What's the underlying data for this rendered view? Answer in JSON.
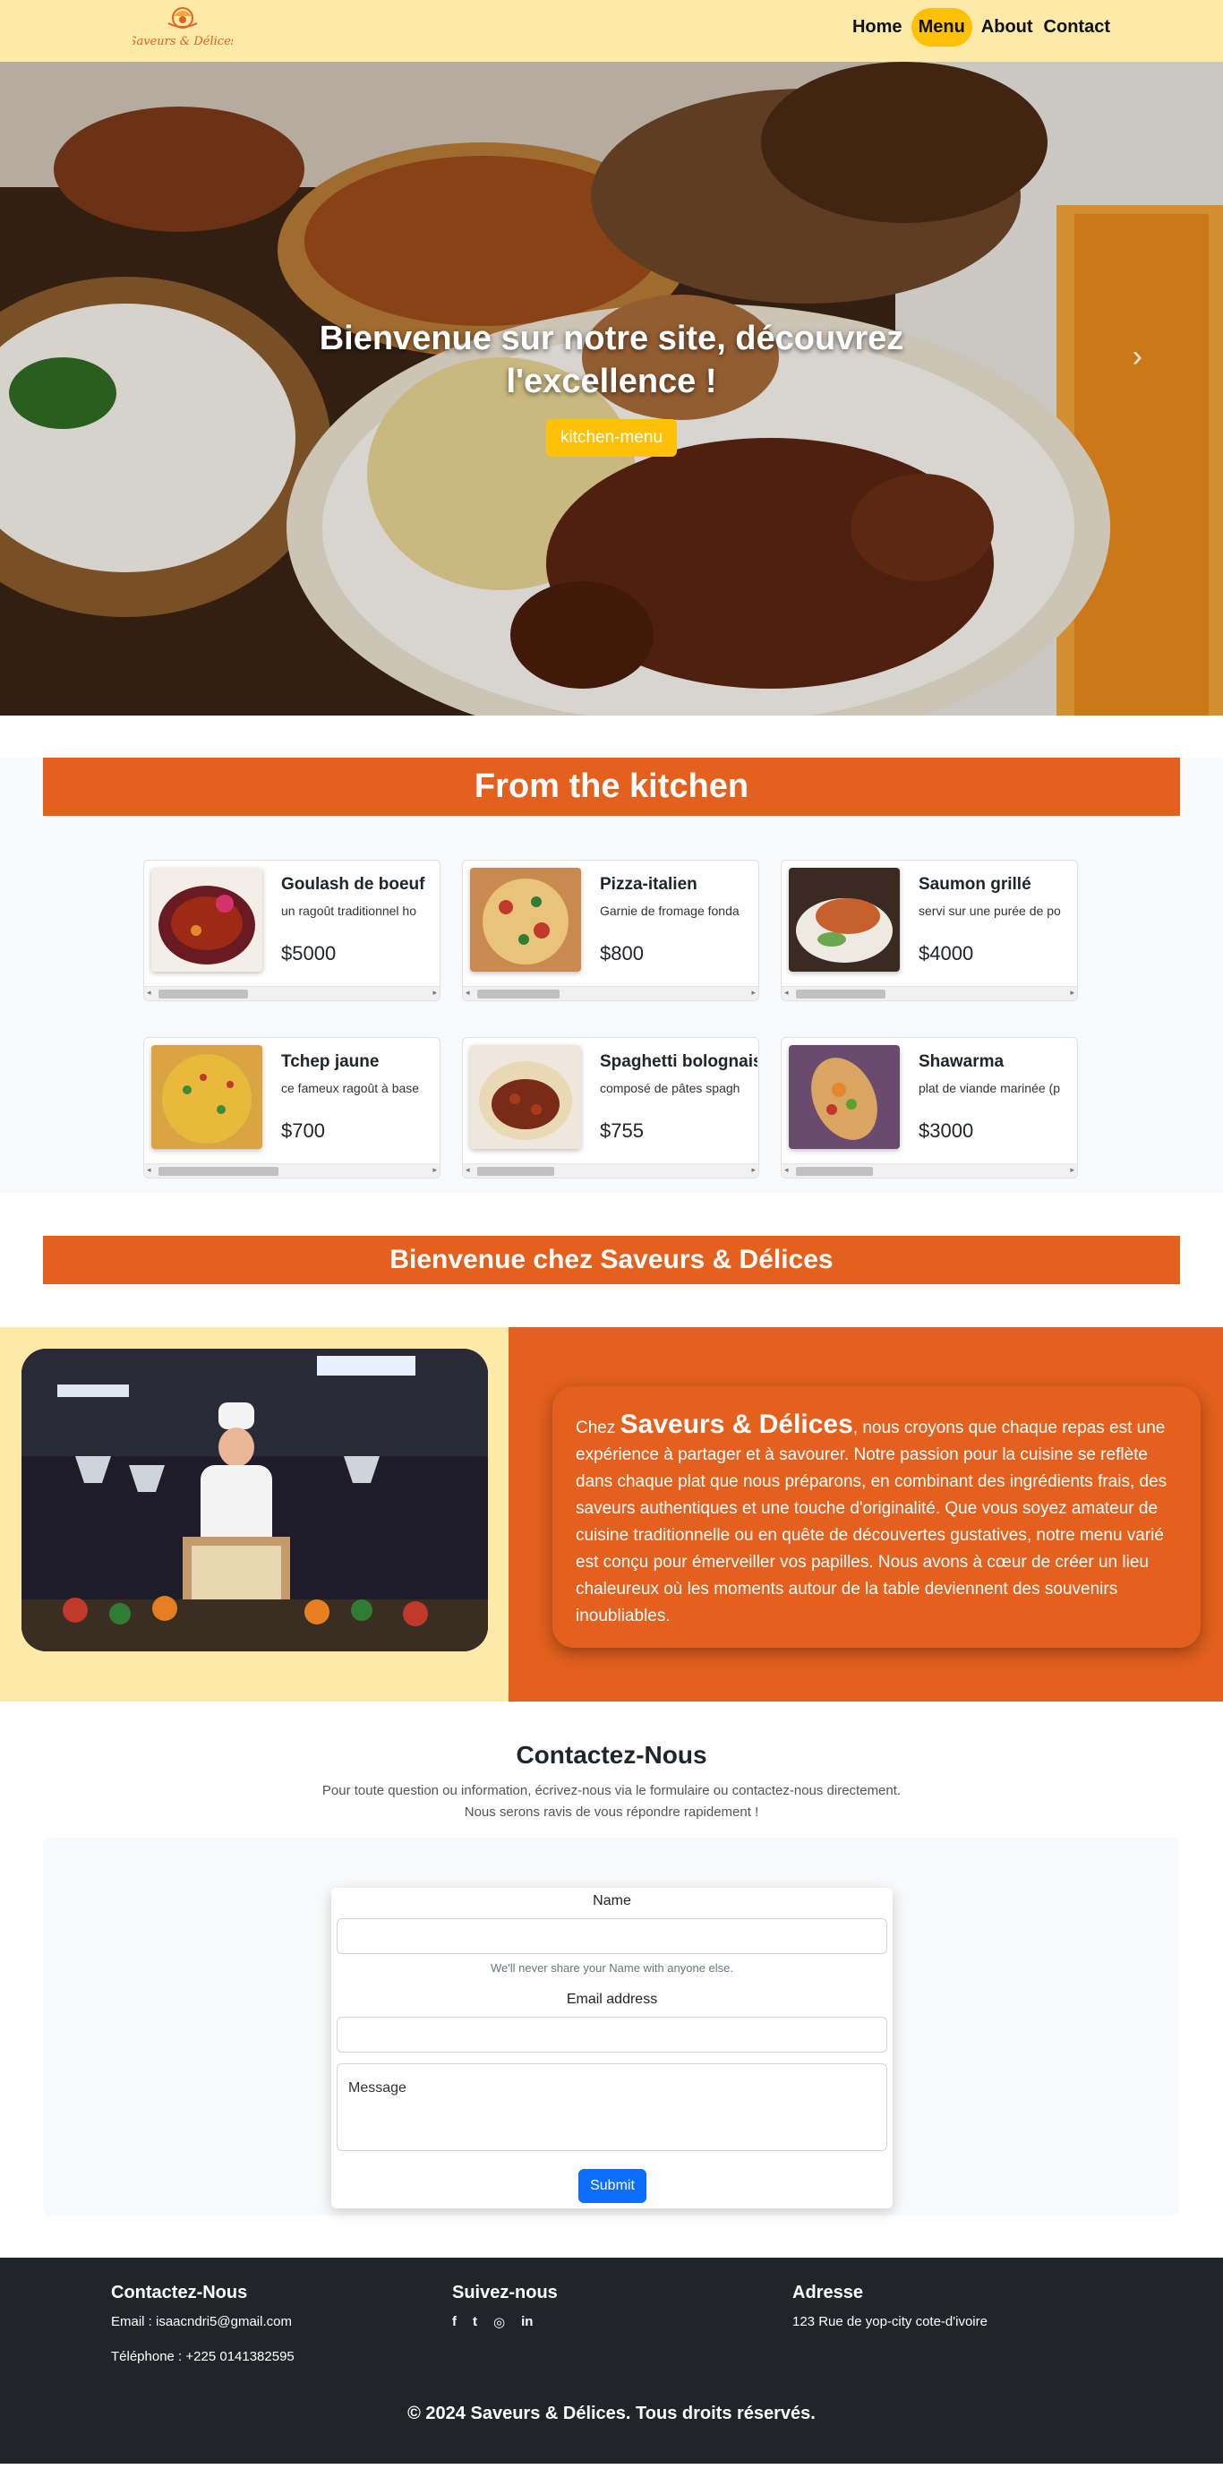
{
  "nav": {
    "logo_text": "Saveurs & Délices",
    "links": [
      {
        "label": "Home"
      },
      {
        "label": "Menu"
      },
      {
        "label": "About"
      },
      {
        "label": "Contact"
      }
    ],
    "active_link": "Menu"
  },
  "hero": {
    "title_line1": "Bienvenue sur notre site, découvrez",
    "title_line2": "l'excellence !",
    "button_label": "kitchen-menu",
    "next_icon": "chevron-right-icon"
  },
  "kitchen": {
    "title": "From the kitchen",
    "items": [
      {
        "name": "Goulash de boeuf",
        "desc": "un ragoût traditionnel ho",
        "price": "$5000"
      },
      {
        "name": "Pizza-italien",
        "desc": "Garnie de fromage fonda",
        "price": "$800"
      },
      {
        "name": "Saumon grillé",
        "desc": "servi sur une purée de po",
        "price": "$4000"
      },
      {
        "name": "Tchep jaune",
        "desc": "ce fameux ragoût à base",
        "price": "$700"
      },
      {
        "name": "Spaghetti bolognais",
        "desc": "composé de pâtes spagh",
        "price": "$755"
      },
      {
        "name": "Shawarma",
        "desc": "plat de viande marinée (p",
        "price": "$3000"
      }
    ]
  },
  "welcome": {
    "title": "Bienvenue chez Saveurs & Délices",
    "intro": "Chez",
    "brand": "Saveurs & Délices",
    "text": ", nous croyons que chaque repas est une expérience à partager et à savourer. Notre passion pour la cuisine se reflète dans chaque plat que nous préparons, en combinant des ingrédients frais, des saveurs authentiques et une touche d'originalité. Que vous soyez amateur de cuisine traditionnelle ou en quête de découvertes gustatives, notre menu varié est conçu pour émerveiller vos papilles. Nous avons à cœur de créer un lieu chaleureux où les moments autour de la table deviennent des souvenirs inoubliables."
  },
  "contact": {
    "title": "Contactez-Nous",
    "subtitle_line1": "Pour toute question ou information, écrivez-nous via le formulaire ou contactez-nous directement.",
    "subtitle_line2": "Nous serons ravis de vous répondre rapidement !",
    "name_label": "Name",
    "name_value": "",
    "name_help": "We'll never share your Name with anyone else.",
    "email_label": "Email address",
    "email_value": "",
    "message_placeholder": "Message",
    "submit_label": "Submit"
  },
  "footer": {
    "contact_title": "Contactez-Nous",
    "email": "Email : isaacndri5@gmail.com",
    "phone": "Téléphone : +225 0141382595",
    "follow_title": "Suivez-nous",
    "social_icons": [
      "facebook-icon",
      "twitter-icon",
      "instagram-icon",
      "linkedin-icon"
    ],
    "social_glyphs": [
      "f",
      "t",
      "◎",
      "in"
    ],
    "address_title": "Adresse",
    "address": "123 Rue de yop-city cote-d'ivoire",
    "copyright": "© 2024 Saveurs & Délices. Tous droits réservés."
  },
  "colors": {
    "navbar_bg": "#fde9a8",
    "accent_orange": "#e4601e",
    "accent_yellow": "#ffc107",
    "footer_bg": "#212529",
    "submit_blue": "#0d6efd"
  }
}
